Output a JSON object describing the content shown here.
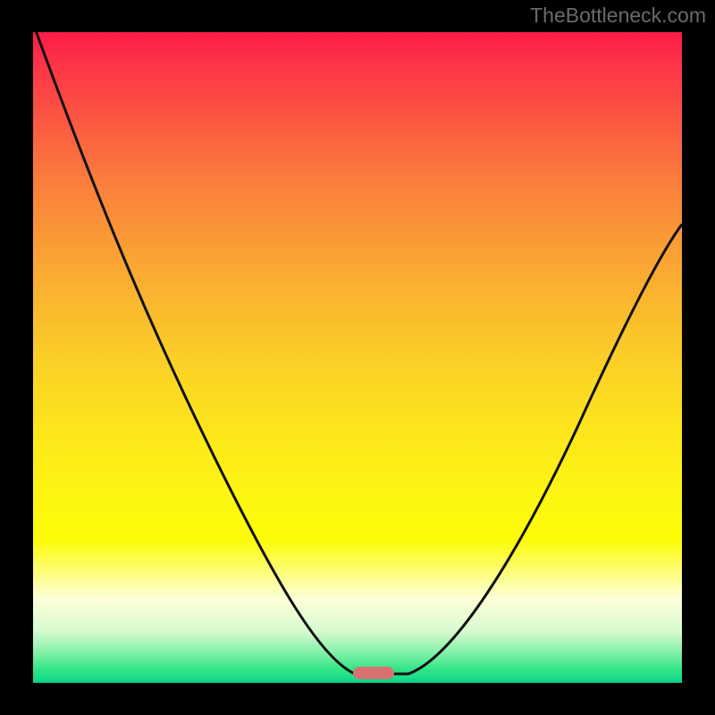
{
  "watermark": "TheBottleneck.com",
  "chart_data": {
    "type": "line",
    "title": "",
    "xlabel": "",
    "ylabel": "",
    "xlim": [
      0,
      100
    ],
    "ylim": [
      0,
      100
    ],
    "x": [
      0,
      5,
      10,
      15,
      20,
      25,
      30,
      35,
      40,
      45,
      50,
      52,
      54,
      56,
      60,
      65,
      70,
      75,
      80,
      85,
      90,
      95,
      100
    ],
    "values": [
      100,
      88,
      76,
      66,
      57,
      49,
      41,
      33,
      25,
      16,
      5,
      1,
      1,
      1,
      5,
      14,
      24,
      34,
      44,
      53,
      61,
      67,
      71
    ],
    "optimal_x": 53,
    "gradient_stops": [
      {
        "pos": 0.0,
        "color": "#fd1b49"
      },
      {
        "pos": 0.4,
        "color": "#fab92e"
      },
      {
        "pos": 0.75,
        "color": "#fdfc07"
      },
      {
        "pos": 1.0,
        "color": "#08cf8b"
      }
    ],
    "marker_color": "#d87272",
    "marker_style": "left:358px; top:710px; background:#d87272;"
  }
}
